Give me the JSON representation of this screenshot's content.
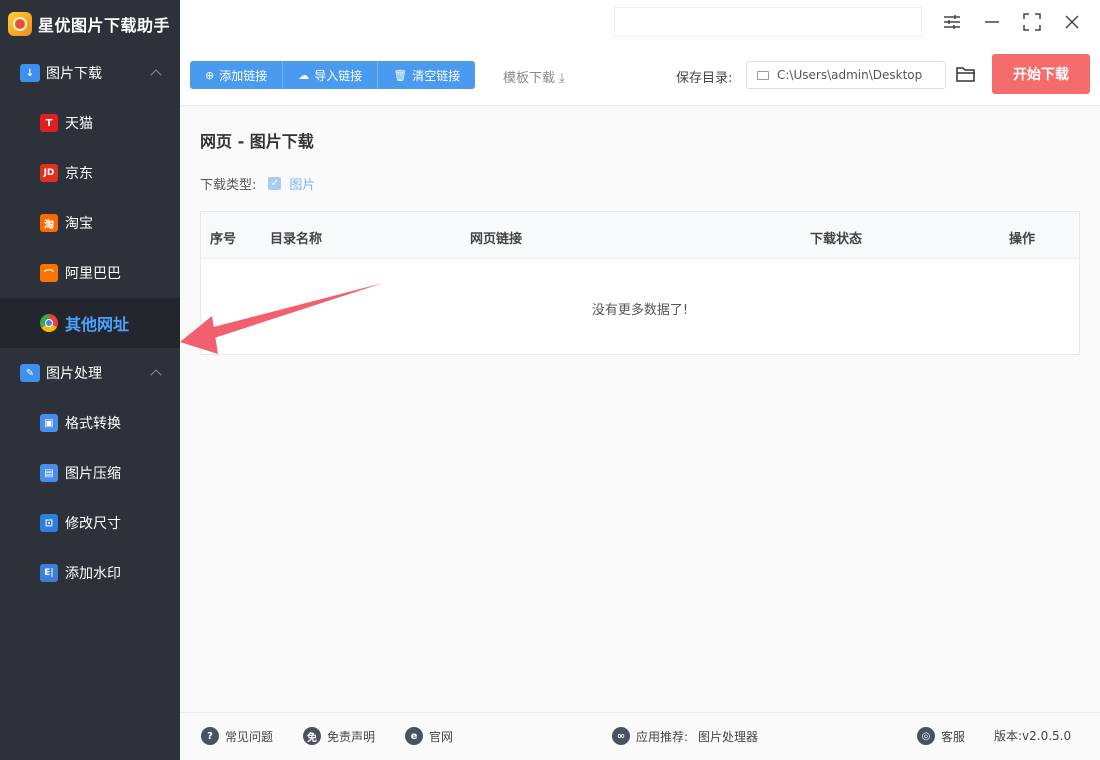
{
  "app": {
    "title": "星优图片下载助手"
  },
  "sidebar": {
    "groups": [
      {
        "label": "图片下载",
        "items": [
          {
            "label": "天猫",
            "icon": "tmall-icon"
          },
          {
            "label": "京东",
            "icon": "jd-icon"
          },
          {
            "label": "淘宝",
            "icon": "taobao-icon"
          },
          {
            "label": "阿里巴巴",
            "icon": "alibaba-icon"
          },
          {
            "label": "其他网址",
            "icon": "chrome-icon",
            "active": true
          }
        ]
      },
      {
        "label": "图片处理",
        "items": [
          {
            "label": "格式转换",
            "icon": "format-convert-icon"
          },
          {
            "label": "图片压缩",
            "icon": "compress-icon"
          },
          {
            "label": "修改尺寸",
            "icon": "resize-icon"
          },
          {
            "label": "添加水印",
            "icon": "watermark-icon"
          }
        ]
      }
    ]
  },
  "toolbar": {
    "add_link": "添加链接",
    "import_link": "导入链接",
    "clear_link": "清空链接",
    "template": "模板下载",
    "save_dir_label": "保存目录:",
    "save_dir_value": "C:\\Users\\admin\\Desktop",
    "start": "开始下载"
  },
  "main": {
    "title": "网页 - 图片下载",
    "type_label": "下载类型:",
    "type_value": "图片",
    "table": {
      "headers": [
        "序号",
        "目录名称",
        "网页链接",
        "下载状态",
        "操作"
      ],
      "empty": "没有更多数据了!"
    }
  },
  "footer": {
    "faq": "常见问题",
    "disclaimer": "免责声明",
    "website": "官网",
    "recommend_label": "应用推荐:",
    "recommend_value": "图片处理器",
    "support": "客服",
    "version": "版本:v2.0.5.0"
  },
  "colors": {
    "sidebar_bg": "#2d3139",
    "accent": "#4a9af0",
    "start_button": "#f56c6c",
    "active_text": "#4aa3ff"
  }
}
